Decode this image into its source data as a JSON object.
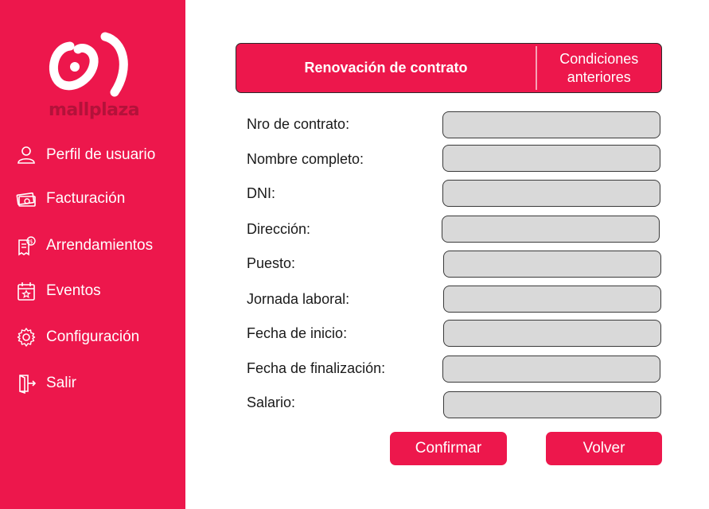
{
  "brand": {
    "name": "mallplaza",
    "accent": "#ED174C"
  },
  "sidebar": {
    "items": [
      {
        "label": "Perfil de usuario",
        "icon": "user-icon"
      },
      {
        "label": "Facturación",
        "icon": "money-icon"
      },
      {
        "label": "Arrendamientos",
        "icon": "invoice-icon"
      },
      {
        "label": "Eventos",
        "icon": "calendar-star-icon"
      },
      {
        "label": "Configuración",
        "icon": "gear-icon"
      },
      {
        "label": "Salir",
        "icon": "logout-icon"
      }
    ]
  },
  "tabs": {
    "active": "Renovación de contrato",
    "other": "Condiciones anteriores"
  },
  "form": {
    "fields": [
      {
        "label": "Nro de contrato:",
        "value": ""
      },
      {
        "label": "Nombre completo:",
        "value": ""
      },
      {
        "label": "DNI:",
        "value": ""
      },
      {
        "label": "Dirección:",
        "value": ""
      },
      {
        "label": "Puesto:",
        "value": ""
      },
      {
        "label": "Jornada laboral:",
        "value": ""
      },
      {
        "label": "Fecha de inicio:",
        "value": ""
      },
      {
        "label": "Fecha de finalización:",
        "value": ""
      },
      {
        "label": "Salario:",
        "value": ""
      }
    ]
  },
  "actions": {
    "confirm": "Confirmar",
    "back": "Volver"
  }
}
